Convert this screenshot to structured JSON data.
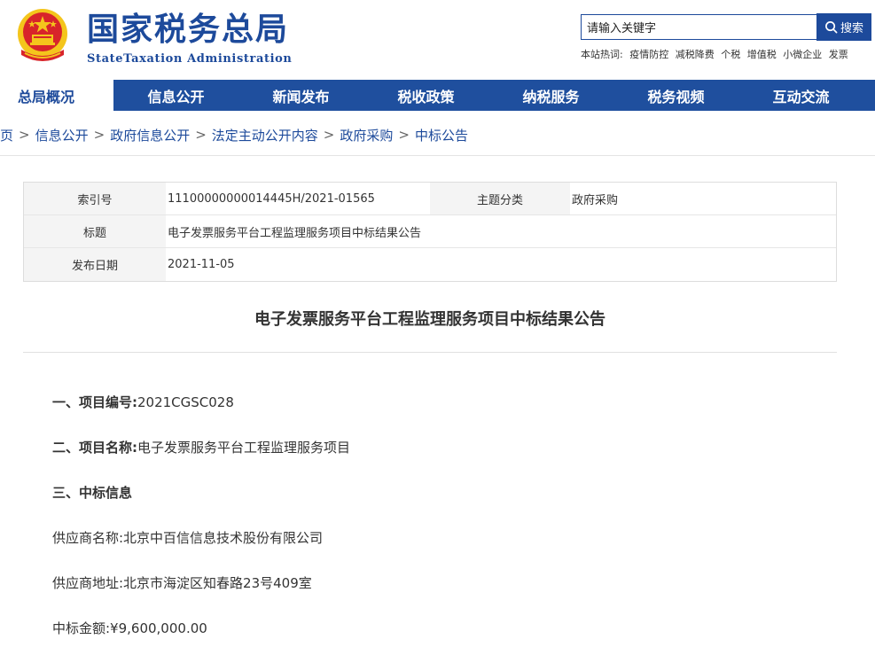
{
  "header": {
    "logo_cn": "国家税务总局",
    "logo_en": "StateTaxation Administration",
    "emblem_icon": "national-emblem-icon",
    "search": {
      "placeholder": "请输入关键字",
      "value": "请输入关键字",
      "button": "搜索"
    },
    "hot_label": "本站热词:",
    "hot_words": [
      "疫情防控",
      "减税降费",
      "个税",
      "增值税",
      "小微企业",
      "发票"
    ]
  },
  "nav": {
    "items": [
      "总局概况",
      "信息公开",
      "新闻发布",
      "税收政策",
      "纳税服务",
      "税务视频",
      "互动交流"
    ]
  },
  "breadcrumb": [
    "页",
    "信息公开",
    "政府信息公开",
    "法定主动公开内容",
    "政府采购",
    "中标公告"
  ],
  "info": {
    "index_label": "索引号",
    "index_value": "11100000000014445H/2021-01565",
    "category_label": "主题分类",
    "category_value": "政府采购",
    "title_label": "标题",
    "title_value": "电子发票服务平台工程监理服务项目中标结果公告",
    "date_label": "发布日期",
    "date_value": "2021-11-05"
  },
  "article": {
    "title": "电子发票服务平台工程监理服务项目中标结果公告",
    "p1_label": "一、项目编号:",
    "p1_value": "2021CGSC028",
    "p2_label": "二、项目名称:",
    "p2_value": "电子发票服务平台工程监理服务项目",
    "p3_label": "三、中标信息",
    "supplier_name": "供应商名称:北京中百信信息技术股份有限公司",
    "supplier_addr": "供应商地址:北京市海淀区知春路23号409室",
    "amount": "中标金额:¥9,600,000.00"
  },
  "colors": {
    "brand": "#1d4a9b",
    "nav_bg": "#1f4f9e",
    "emblem_red": "#d8242a",
    "emblem_gold": "#f4c51c"
  }
}
